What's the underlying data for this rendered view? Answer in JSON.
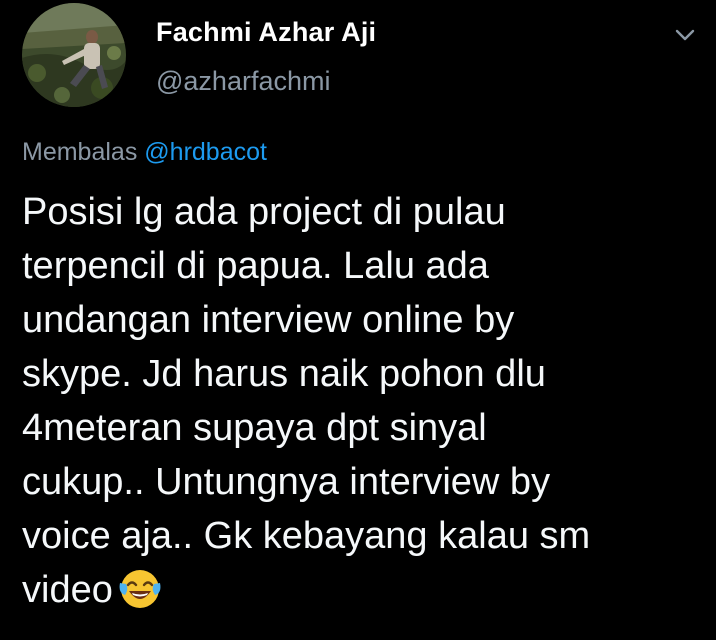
{
  "author": {
    "name": "Fachmi Azhar Aji",
    "handle": "@azharfachmi"
  },
  "reply": {
    "prefix": "Membalas",
    "mention": "@hrdbacot"
  },
  "tweet": {
    "text": "Posisi lg ada project di pulau\nterpencil di papua. Lalu ada\nundangan interview online by\nskype. Jd harus naik pohon dlu\n4meteran supaya dpt sinyal\ncukup.. Untungnya  interview by\nvoice aja.. Gk kebayang kalau sm\nvideo",
    "emoji": "face-with-tears-of-joy"
  },
  "icons": {
    "menu": "chevron-down-icon"
  },
  "colors": {
    "background": "#000000",
    "text": "#f5f8fa",
    "secondary": "#8b98a5",
    "link": "#1d9bf0"
  }
}
